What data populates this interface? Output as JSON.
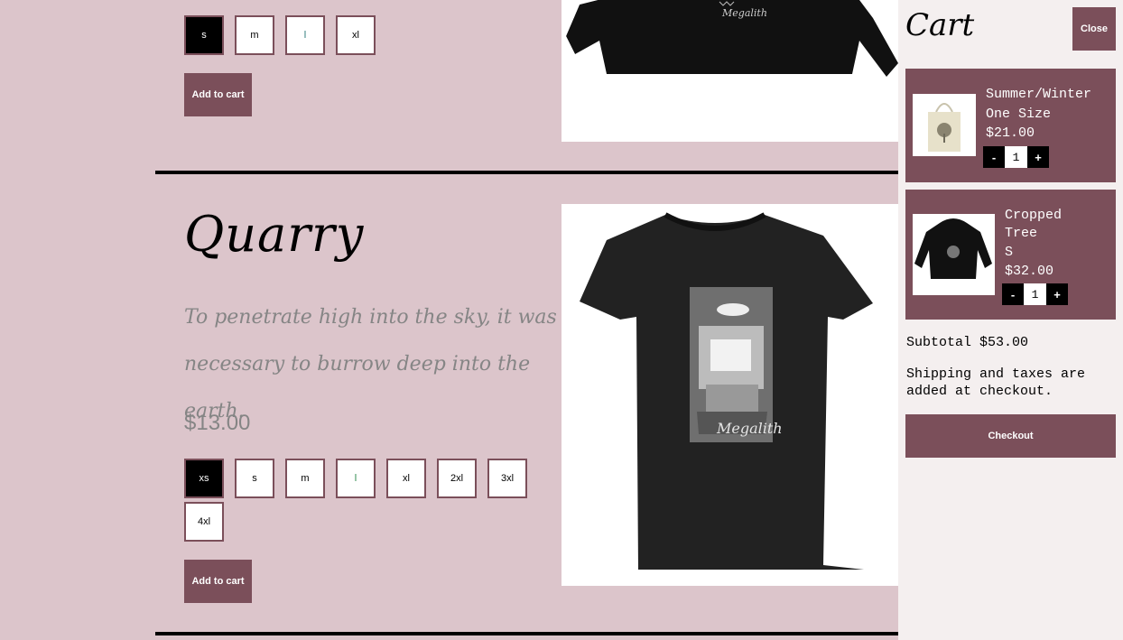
{
  "product_top": {
    "sizes": [
      {
        "label": "s",
        "selected": true
      },
      {
        "label": "m",
        "selected": false
      },
      {
        "label": "l",
        "selected": false
      },
      {
        "label": "xl",
        "selected": false
      }
    ],
    "add_label": "Add to cart",
    "image_icon": "black-cropped-sweatshirt-image",
    "image_brand": "Megalith"
  },
  "product_main": {
    "title": "Quarry",
    "description": "To penetrate high into the sky, it was necessary to burrow deep into the earth.",
    "price": "$13.00",
    "sizes": [
      {
        "label": "xs",
        "selected": true
      },
      {
        "label": "s",
        "selected": false
      },
      {
        "label": "m",
        "selected": false
      },
      {
        "label": "l",
        "selected": false
      },
      {
        "label": "xl",
        "selected": false
      },
      {
        "label": "2xl",
        "selected": false
      },
      {
        "label": "3xl",
        "selected": false
      },
      {
        "label": "4xl",
        "selected": false
      }
    ],
    "add_label": "Add to cart",
    "image_icon": "black-tshirt-image",
    "image_brand": "Megalith"
  },
  "cart": {
    "title": "Cart",
    "close_label": "Close",
    "items": [
      {
        "name": "Summer/Winter",
        "variant": "One Size",
        "price": "$21.00",
        "qty": "1",
        "minus": "-",
        "plus": "+",
        "image_icon": "tote-bag-image"
      },
      {
        "name": "Cropped Tree",
        "variant": "S",
        "price": "$32.00",
        "qty": "1",
        "minus": "-",
        "plus": "+",
        "image_icon": "cropped-hoodie-image"
      }
    ],
    "subtotal": "Subtotal $53.00",
    "shipping_note": "Shipping and taxes are added at checkout.",
    "checkout_label": "Checkout"
  },
  "colors": {
    "page_bg": "#dcc5cb",
    "accent": "#7b4f5a",
    "cart_bg": "#f4efef"
  }
}
